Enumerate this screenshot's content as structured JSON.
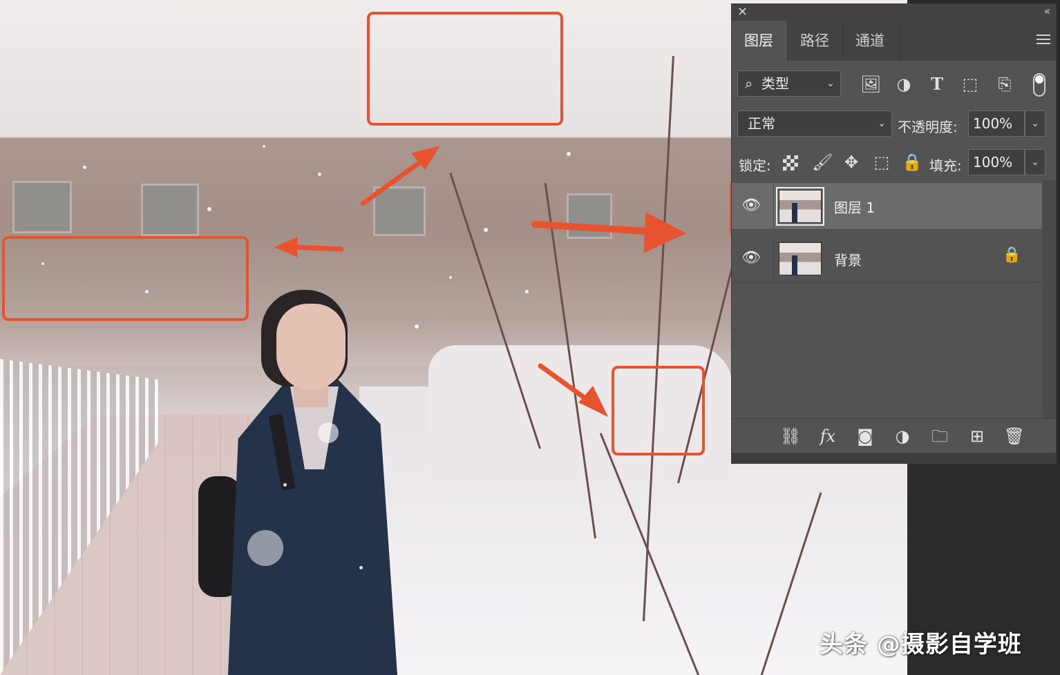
{
  "panel": {
    "close_icon": "close-icon",
    "collapse_icon": "collapse-icon",
    "tabs": [
      {
        "label": "图层",
        "active": true
      },
      {
        "label": "路径",
        "active": false
      },
      {
        "label": "通道",
        "active": false
      }
    ],
    "filter": {
      "kind_label": "类型",
      "icons": [
        "image-filter-icon",
        "adjustment-filter-icon",
        "type-filter-icon",
        "shape-filter-icon",
        "smart-object-filter-icon",
        "filter-toggle-icon"
      ]
    },
    "blend_mode": "正常",
    "opacity_label": "不透明度:",
    "opacity_value": "100%",
    "lock_label": "锁定:",
    "lock_icons": [
      "lock-transparent-icon",
      "lock-image-icon",
      "lock-position-icon",
      "lock-artboard-icon",
      "lock-all-icon"
    ],
    "fill_label": "填充:",
    "fill_value": "100%",
    "layers": [
      {
        "name": "图层 1",
        "visible": true,
        "selected": true,
        "locked": false
      },
      {
        "name": "背景",
        "visible": true,
        "selected": false,
        "locked": true
      }
    ],
    "bottom_icons": [
      "link-layers-icon",
      "fx-icon",
      "layer-mask-icon",
      "adjustment-layer-icon",
      "group-folder-icon",
      "new-layer-icon",
      "delete-icon"
    ]
  },
  "watermark": "头条 @摄影自学班",
  "colors": {
    "annotation": "#e8532f",
    "panel_bg": "#535353",
    "panel_dark": "#424242",
    "selected_layer": "#6b6b6b"
  }
}
